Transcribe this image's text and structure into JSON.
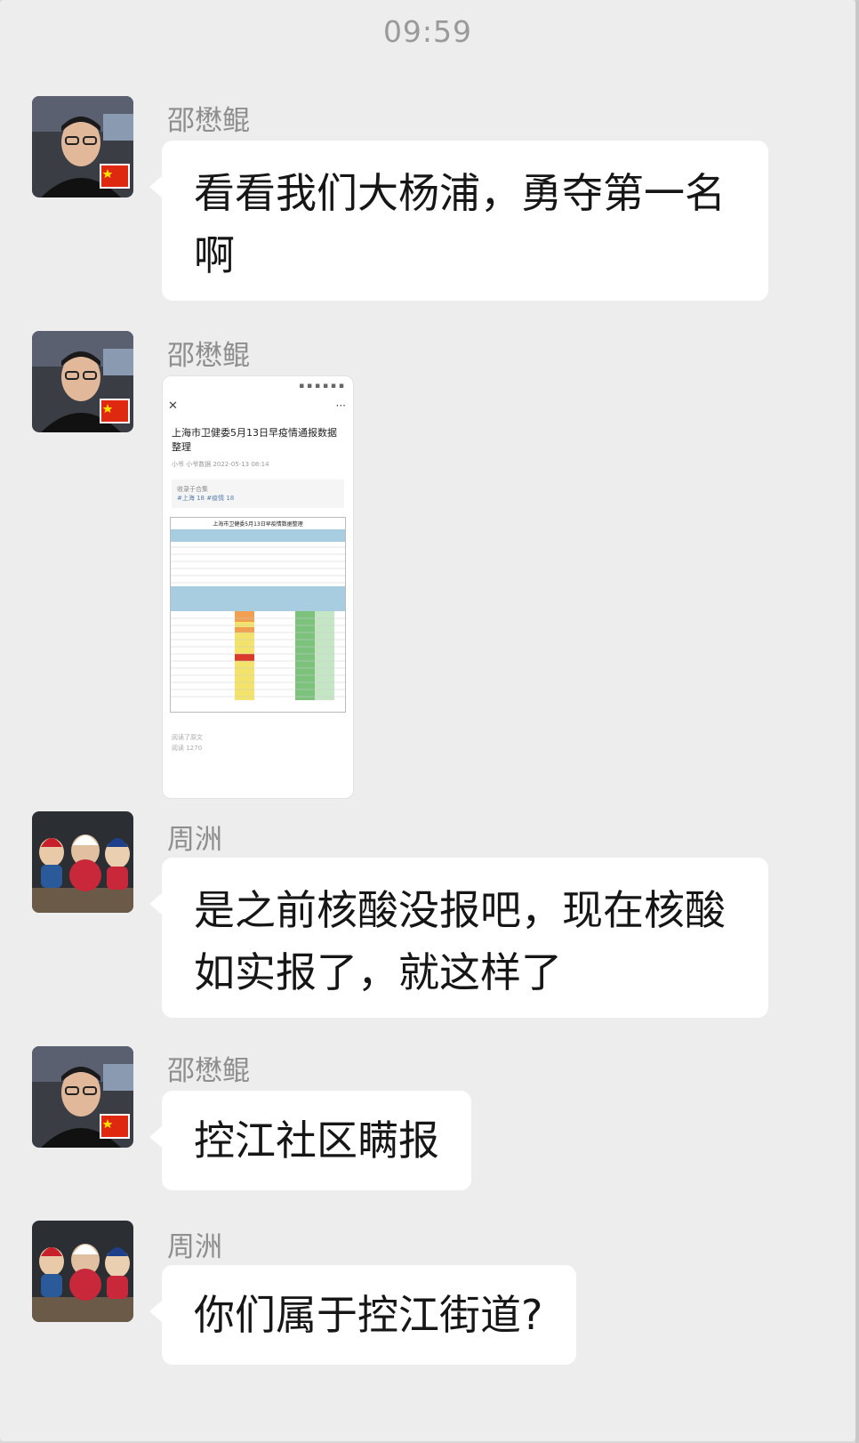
{
  "time": "09:59",
  "messages": [
    {
      "sender": "邵懋鲲",
      "text_line1": "看看我们大杨浦，勇夺第一名",
      "text_line2": "啊"
    },
    {
      "sender": "邵懋鲲",
      "image": {
        "title": "上海市卫健委5月13日早疫情通报数据整理",
        "byline": "小爷 小爷数据 2022-05-13 08:14",
        "tags_heading": "收录于合集",
        "tags": "#上海 18 #疫情 18",
        "table_title": "上海市卫健委5月13日早疫情数据整理",
        "footer1": "阅读了原文",
        "footer2": "阅读 1270"
      }
    },
    {
      "sender": "周洲",
      "text_line1": "是之前核酸没报吧，现在核酸",
      "text_line2": "如实报了，就这样了"
    },
    {
      "sender": "邵懋鲲",
      "text_line1": "控江社区瞒报"
    },
    {
      "sender": "周洲",
      "text_line1": "你们属于控江街道?"
    }
  ],
  "colors": {
    "background": "#ededed",
    "bubble": "#ffffff",
    "name": "#8e8e8e",
    "time": "#9a9a9a"
  },
  "icons": [
    "china-flag-badge-icon",
    "close-icon",
    "more-icon"
  ]
}
